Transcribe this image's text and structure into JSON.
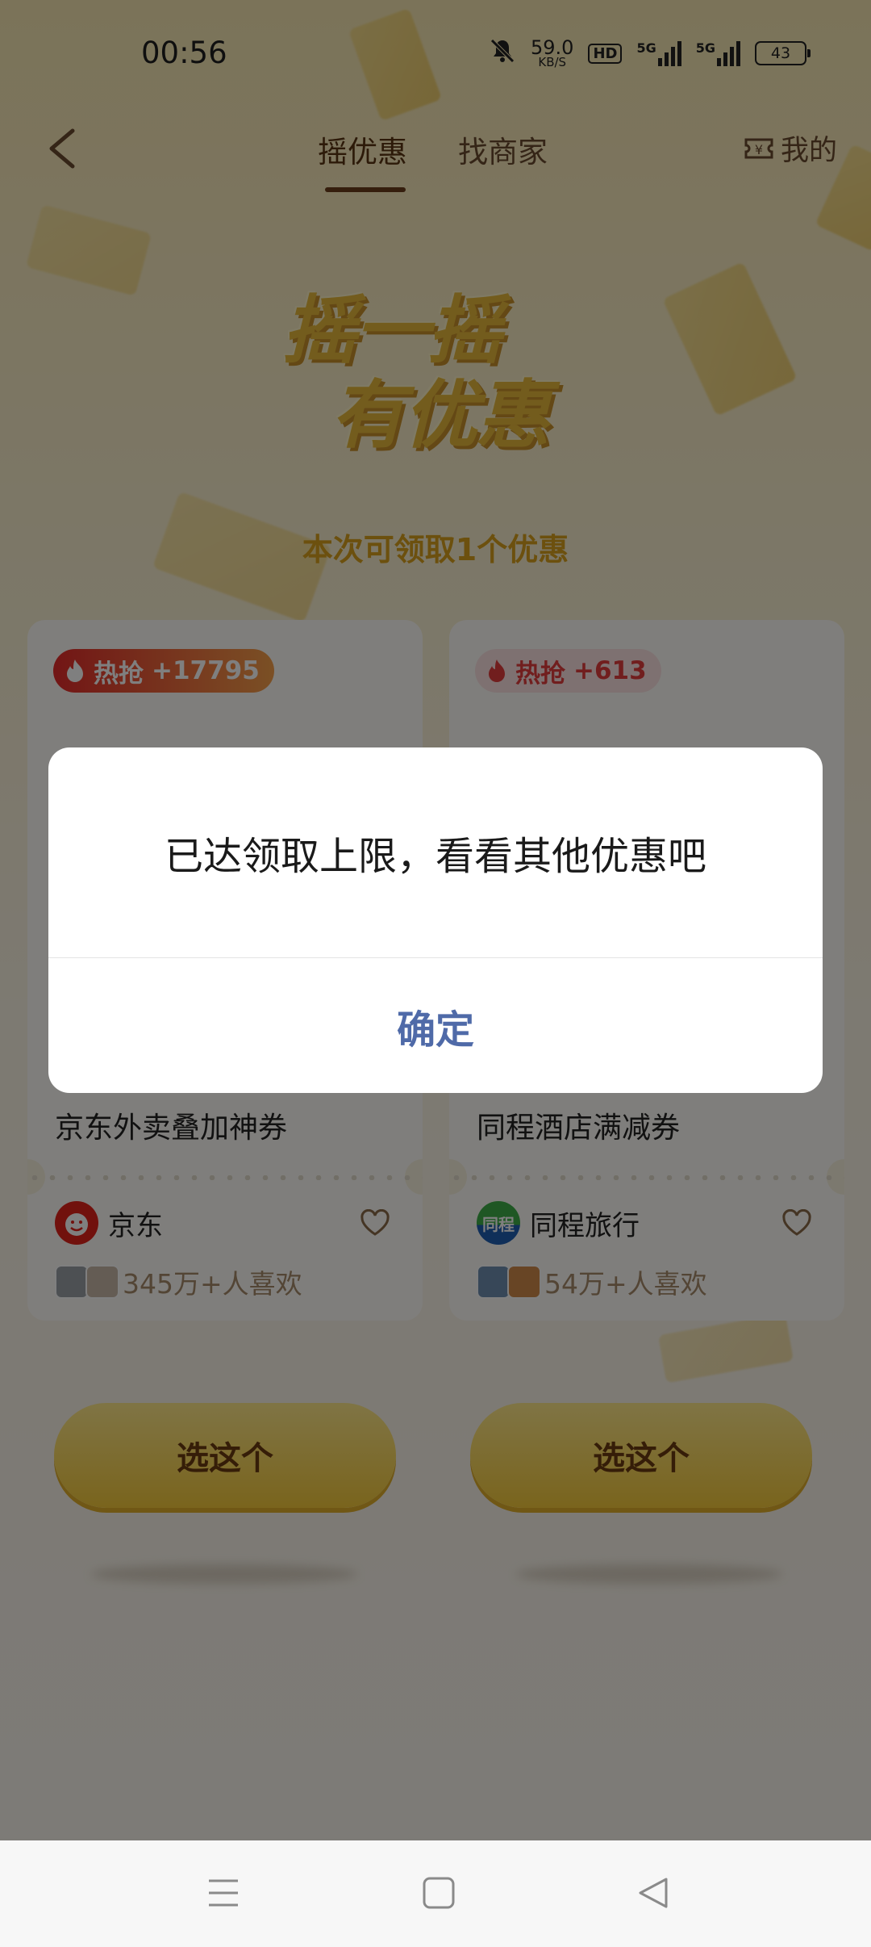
{
  "status_bar": {
    "time": "00:56",
    "net_speed": "59.0",
    "net_unit": "KB/S",
    "hd": "HD",
    "sim1": "5G",
    "sim2": "5G",
    "battery": "43"
  },
  "header": {
    "tabs": [
      {
        "label": "摇优惠",
        "active": true
      },
      {
        "label": "找商家",
        "active": false
      }
    ],
    "mine_label": "我的"
  },
  "hero": {
    "line1": "摇一摇",
    "line2": "有优惠",
    "subtitle": "本次可领取1个优惠"
  },
  "cards": [
    {
      "hot_label": "热抢",
      "hot_count": "+17795",
      "title": "京东外卖叠加神券",
      "brand": "京东",
      "likes": "345万+人喜欢",
      "button": "选这个"
    },
    {
      "hot_label": "热抢",
      "hot_count": "+613",
      "title": "同程酒店满减券",
      "brand": "同程旅行",
      "brand_logo_text": "同程",
      "likes": "54万+人喜欢",
      "button": "选这个"
    }
  ],
  "dialog": {
    "message": "已达领取上限，看看其他优惠吧",
    "confirm": "确定"
  },
  "colors": {
    "accent_gold": "#e7b83a",
    "hot_red": "#e52b2b",
    "dialog_button": "#4f6aa8"
  },
  "icons": [
    "back-arrow-icon",
    "ticket-icon",
    "fire-icon",
    "heart-icon",
    "menu-icon",
    "home-icon",
    "back-triangle-icon",
    "mute-icon"
  ]
}
